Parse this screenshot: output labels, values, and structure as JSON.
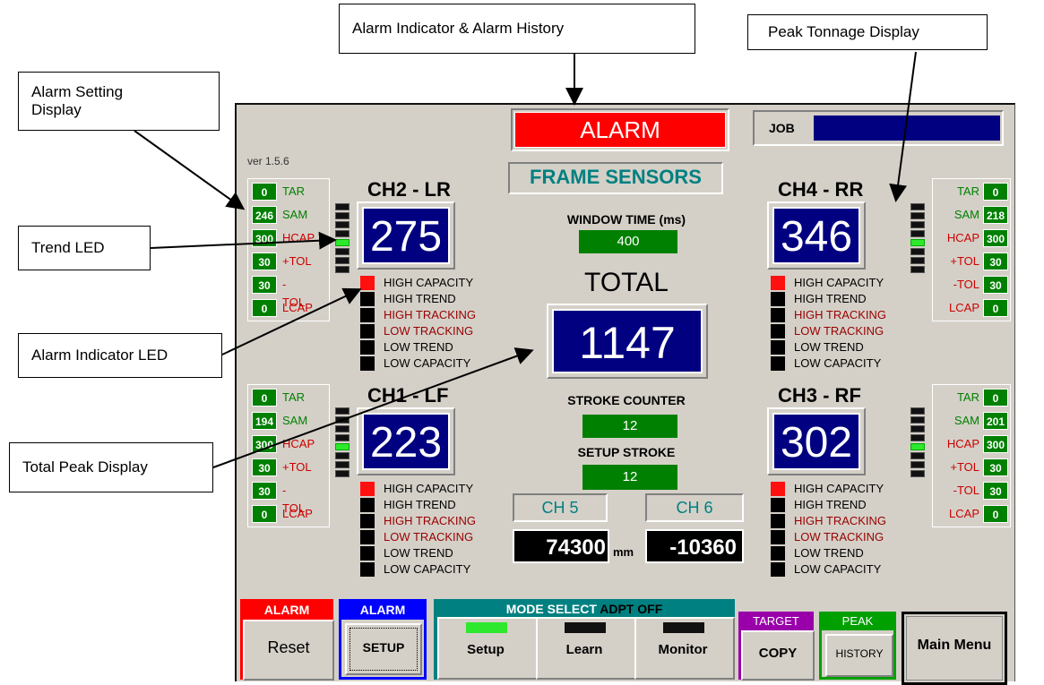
{
  "callouts": {
    "alarm_indicator_history": "Alarm Indicator & Alarm History",
    "peak_tonnage": "Peak Tonnage Display",
    "alarm_setting": "Alarm Setting Display",
    "trend_led": "Trend LED",
    "alarm_indicator_led": "Alarm Indicator LED",
    "total_peak": "Total Peak Display"
  },
  "header": {
    "alarm": "ALARM",
    "job_label": "JOB",
    "job_value": "",
    "version": "ver 1.5.6",
    "title": "FRAME SENSORS"
  },
  "setting_labels": [
    "TAR",
    "SAM",
    "HCAP",
    "+TOL",
    "-TOL",
    "LCAP"
  ],
  "channels": {
    "ch2": {
      "title": "CH2 - LR",
      "peak": "275",
      "settings": [
        "0",
        "246",
        "300",
        "30",
        "30",
        "0"
      ]
    },
    "ch4": {
      "title": "CH4 - RR",
      "peak": "346",
      "settings": [
        "0",
        "218",
        "300",
        "30",
        "30",
        "0"
      ]
    },
    "ch1": {
      "title": "CH1 - LF",
      "peak": "223",
      "settings": [
        "0",
        "194",
        "300",
        "30",
        "30",
        "0"
      ]
    },
    "ch3": {
      "title": "CH3 - RF",
      "peak": "302",
      "settings": [
        "0",
        "201",
        "300",
        "30",
        "30",
        "0"
      ]
    }
  },
  "alarm_labels": [
    "HIGH CAPACITY",
    "HIGH TREND",
    "HIGH TRACKING",
    "LOW TRACKING",
    "LOW TREND",
    "LOW CAPACITY"
  ],
  "center": {
    "window_time_label": "WINDOW TIME (ms)",
    "window_time": "400",
    "total_label": "TOTAL",
    "total": "1147",
    "stroke_counter_label": "STROKE COUNTER",
    "stroke_counter": "12",
    "setup_stroke_label": "SETUP STROKE",
    "setup_stroke": "12",
    "ch5_label": "CH 5",
    "ch5_value": "74300",
    "unit": "mm",
    "ch6_label": "CH 6",
    "ch6_value": "-10360"
  },
  "bottom": {
    "alarm_reset_header": "ALARM",
    "reset": "Reset",
    "alarm_setup_header": "ALARM",
    "setup": "SETUP",
    "mode_select": "MODE SELECT",
    "adpt": "ADPT OFF",
    "mode_setup": "Setup",
    "mode_learn": "Learn",
    "mode_monitor": "Monitor",
    "target_header": "TARGET",
    "copy": "COPY",
    "peak_header": "PEAK",
    "history": "HISTORY",
    "main_menu": "Main Menu"
  },
  "colors": {
    "panel": "#d4d0c8",
    "navy": "#000080",
    "green": "#008000",
    "teal": "#008080",
    "alarm_red": "#ff0000",
    "led_green": "#2ee82e"
  }
}
